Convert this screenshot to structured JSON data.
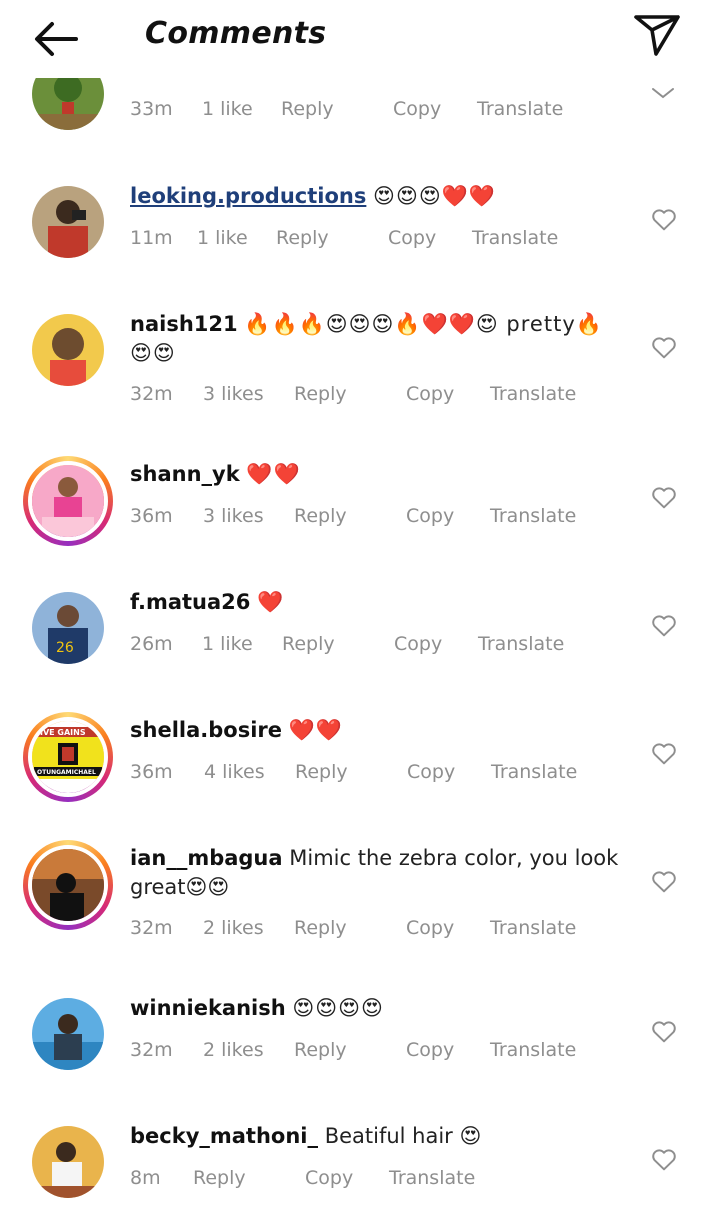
{
  "header": {
    "title": "Comments",
    "back_icon": "arrow-left-icon",
    "send_icon": "send-paper-plane-icon"
  },
  "colors": {
    "username_link": "#1f3f7a",
    "meta": "#8e8e8e",
    "heart_red": "#ed1c24"
  },
  "comments": [
    {
      "username": "",
      "text": "",
      "time": "33m",
      "likes": "1 like",
      "reply": "Reply",
      "copy": "Copy",
      "translate": "Translate"
    },
    {
      "username": "leoking.productions",
      "text": "😍😍😍❤️❤️",
      "time": "11m",
      "likes": "1 like",
      "reply": "Reply",
      "copy": "Copy",
      "translate": "Translate"
    },
    {
      "username": "naish121",
      "text": "🔥🔥🔥😍😍😍🔥❤️❤️😍 pretty🔥😍😍",
      "time": "32m",
      "likes": "3 likes",
      "reply": "Reply",
      "copy": "Copy",
      "translate": "Translate"
    },
    {
      "username": "shann_yk",
      "text": "❤️❤️",
      "time": "36m",
      "likes": "3 likes",
      "reply": "Reply",
      "copy": "Copy",
      "translate": "Translate"
    },
    {
      "username": "f.matua26",
      "text": "❤️",
      "time": "26m",
      "likes": "1 like",
      "reply": "Reply",
      "copy": "Copy",
      "translate": "Translate"
    },
    {
      "username": "shella.bosire",
      "text": "❤️❤️",
      "time": "36m",
      "likes": "4 likes",
      "reply": "Reply",
      "copy": "Copy",
      "translate": "Translate",
      "avatar_text": [
        "IVE GAINS",
        "OTUNGAMICHAEL"
      ]
    },
    {
      "username": "ian__mbagua",
      "text": "Mimic the zebra color,  you look great😍😍",
      "time": "32m",
      "likes": "2 likes",
      "reply": "Reply",
      "copy": "Copy",
      "translate": "Translate"
    },
    {
      "username": "winniekanish",
      "text": "😍😍😍😍",
      "time": "32m",
      "likes": "2 likes",
      "reply": "Reply",
      "copy": "Copy",
      "translate": "Translate"
    },
    {
      "username": "becky_mathoni_",
      "text": "Beatiful hair 😍",
      "time": "8m",
      "likes": "",
      "reply": "Reply",
      "copy": "Copy",
      "translate": "Translate"
    }
  ]
}
